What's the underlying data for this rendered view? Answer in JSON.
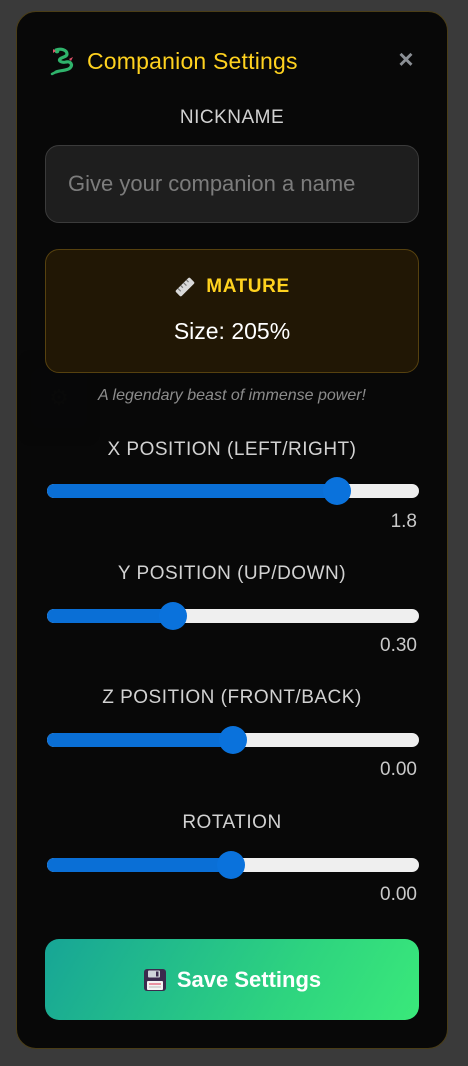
{
  "background_button": {
    "icon": "gear-icon"
  },
  "header": {
    "icon": "dragon-icon",
    "title": "Companion Settings",
    "close_label": "×"
  },
  "nickname": {
    "label": "NICKNAME",
    "value": "",
    "placeholder": "Give your companion a name"
  },
  "stage": {
    "icon": "ruler-icon",
    "name": "MATURE",
    "size_text": "Size: 205%",
    "description": "A legendary beast of immense power!"
  },
  "sliders": [
    {
      "key": "x",
      "label": "X POSITION (LEFT/RIGHT)",
      "value_text": "1.8",
      "fraction": 0.78
    },
    {
      "key": "y",
      "label": "Y POSITION (UP/DOWN)",
      "value_text": "0.30",
      "fraction": 0.34
    },
    {
      "key": "z",
      "label": "Z POSITION (FRONT/BACK)",
      "value_text": "0.00",
      "fraction": 0.5
    },
    {
      "key": "rotation",
      "label": "ROTATION",
      "value_text": "0.00",
      "fraction": 0.495
    }
  ],
  "save": {
    "icon": "floppy-disk-icon",
    "label": "Save Settings"
  },
  "colors": {
    "accent_gold": "#ffd21f",
    "slider_blue": "#0a6fd6",
    "save_gradient_start": "#17a596",
    "save_gradient_end": "#3ae97a"
  }
}
